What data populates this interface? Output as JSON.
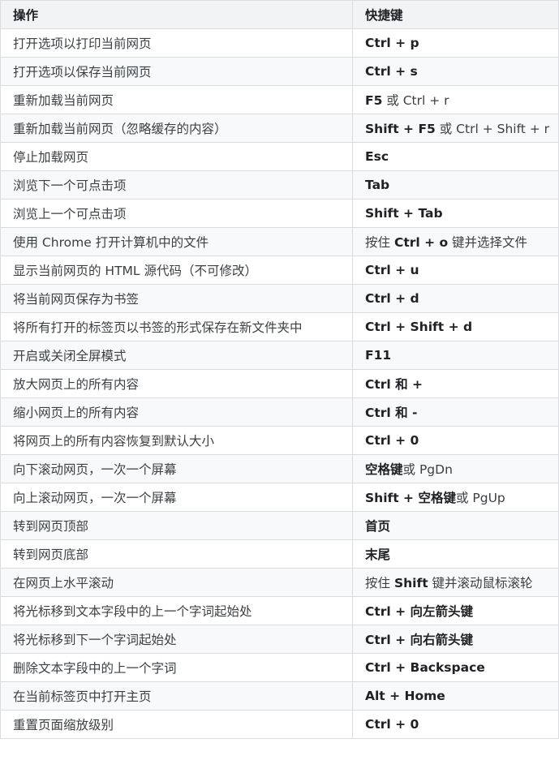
{
  "table": {
    "headers": {
      "action": "操作",
      "shortcut": "快捷键"
    },
    "rows": [
      {
        "action": "打开选项以打印当前网页",
        "keys": [
          {
            "t": "Ctrl + p",
            "b": true
          }
        ]
      },
      {
        "action": "打开选项以保存当前网页",
        "keys": [
          {
            "t": "Ctrl + s",
            "b": true
          }
        ]
      },
      {
        "action": "重新加载当前网页",
        "keys": [
          {
            "t": "F5",
            "b": true
          },
          {
            "t": " 或 Ctrl + r",
            "b": false
          }
        ]
      },
      {
        "action": "重新加载当前网页（忽略缓存的内容）",
        "keys": [
          {
            "t": "Shift + F5",
            "b": true
          },
          {
            "t": " 或 Ctrl + Shift + r",
            "b": false
          }
        ]
      },
      {
        "action": "停止加载网页",
        "keys": [
          {
            "t": "Esc",
            "b": true
          }
        ]
      },
      {
        "action": "浏览下一个可点击项",
        "keys": [
          {
            "t": "Tab",
            "b": true
          }
        ]
      },
      {
        "action": "浏览上一个可点击项",
        "keys": [
          {
            "t": "Shift + Tab",
            "b": true
          }
        ]
      },
      {
        "action": "使用 Chrome 打开计算机中的文件",
        "keys": [
          {
            "t": "按住 ",
            "b": false
          },
          {
            "t": "Ctrl + o",
            "b": true
          },
          {
            "t": " 键并选择文件",
            "b": false
          }
        ]
      },
      {
        "action": "显示当前网页的 HTML 源代码（不可修改）",
        "keys": [
          {
            "t": "Ctrl + u",
            "b": true
          }
        ]
      },
      {
        "action": "将当前网页保存为书签",
        "keys": [
          {
            "t": "Ctrl + d",
            "b": true
          }
        ]
      },
      {
        "action": "将所有打开的标签页以书签的形式保存在新文件夹中",
        "keys": [
          {
            "t": "Ctrl + Shift + d",
            "b": true
          }
        ]
      },
      {
        "action": "开启或关闭全屏模式",
        "keys": [
          {
            "t": "F11",
            "b": true
          }
        ]
      },
      {
        "action": "放大网页上的所有内容",
        "keys": [
          {
            "t": "Ctrl 和 +",
            "b": true
          }
        ]
      },
      {
        "action": "缩小网页上的所有内容",
        "keys": [
          {
            "t": "Ctrl 和 -",
            "b": true
          }
        ]
      },
      {
        "action": "将网页上的所有内容恢复到默认大小",
        "keys": [
          {
            "t": "Ctrl + 0",
            "b": true
          }
        ]
      },
      {
        "action": "向下滚动网页，一次一个屏幕",
        "keys": [
          {
            "t": "空格键",
            "b": true
          },
          {
            "t": "或 PgDn",
            "b": false
          }
        ]
      },
      {
        "action": "向上滚动网页，一次一个屏幕",
        "keys": [
          {
            "t": "Shift + 空格键",
            "b": true
          },
          {
            "t": "或 PgUp",
            "b": false
          }
        ]
      },
      {
        "action": "转到网页顶部",
        "keys": [
          {
            "t": "首页",
            "b": true
          }
        ]
      },
      {
        "action": "转到网页底部",
        "keys": [
          {
            "t": "末尾",
            "b": true
          }
        ]
      },
      {
        "action": "在网页上水平滚动",
        "keys": [
          {
            "t": "按住 ",
            "b": false
          },
          {
            "t": "Shift",
            "b": true
          },
          {
            "t": " 键并滚动鼠标滚轮",
            "b": false
          }
        ]
      },
      {
        "action": "将光标移到文本字段中的上一个字词起始处",
        "keys": [
          {
            "t": "Ctrl + 向左箭头键",
            "b": true
          }
        ]
      },
      {
        "action": "将光标移到下一个字词起始处",
        "keys": [
          {
            "t": "Ctrl + 向右箭头键",
            "b": true
          }
        ]
      },
      {
        "action": "删除文本字段中的上一个字词",
        "keys": [
          {
            "t": "Ctrl + Backspace",
            "b": true
          }
        ]
      },
      {
        "action": "在当前标签页中打开主页",
        "keys": [
          {
            "t": "Alt + Home",
            "b": true
          }
        ]
      },
      {
        "action": "重置页面缩放级别",
        "keys": [
          {
            "t": "Ctrl + 0",
            "b": true
          }
        ]
      }
    ]
  }
}
